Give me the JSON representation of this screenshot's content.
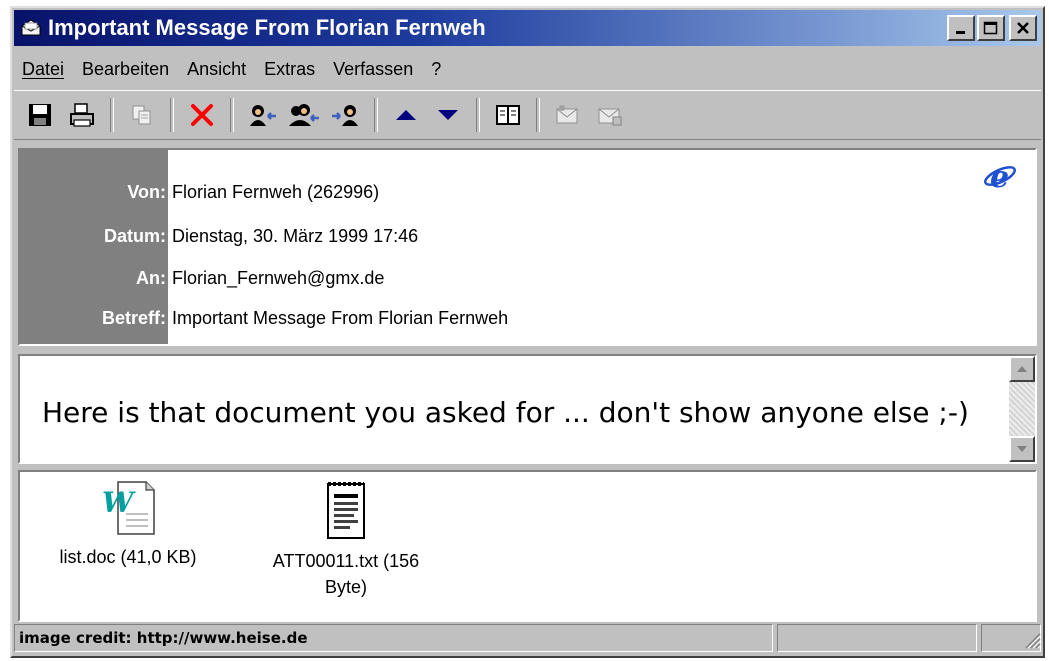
{
  "window": {
    "title": "Important Message From Florian Fernweh",
    "controls": {
      "minimize": "_",
      "maximize": "□",
      "close": "×"
    }
  },
  "menu": {
    "items": [
      "Datei",
      "Bearbeiten",
      "Ansicht",
      "Extras",
      "Verfassen",
      "?"
    ]
  },
  "toolbar": {
    "icons": [
      "save-icon",
      "print-icon",
      "copy-icon",
      "delete-icon",
      "reply-icon",
      "reply-all-icon",
      "forward-icon",
      "previous-icon",
      "next-icon",
      "address-book-icon",
      "send-icon",
      "mail-icon"
    ],
    "delete_color": "#ff0000",
    "arrow_color": "#000080"
  },
  "header": {
    "fields": [
      {
        "label": "Von:",
        "value": "Florian Fernweh (262996)"
      },
      {
        "label": "Datum:",
        "value": "Dienstag, 30. März 1999 17:46"
      },
      {
        "label": "An:",
        "value": "Florian_Fernweh@gmx.de"
      },
      {
        "label": "Betreff:",
        "value": "Important Message From Florian Fernweh"
      }
    ],
    "logo": "ie-logo"
  },
  "message": {
    "text": "Here is that document you asked for ... don't show anyone else ;-)"
  },
  "attachments": [
    {
      "icon": "word-document-icon",
      "name_line1": "list.doc (41,0 KB)",
      "name_line2": ""
    },
    {
      "icon": "text-file-icon",
      "name_line1": "ATT00011.txt (156",
      "name_line2": "Byte)"
    }
  ],
  "statusbar": {
    "text": "image credit: http://www.heise.de"
  },
  "colors": {
    "title_gradient_start": "#08126b",
    "title_gradient_end": "#a8c8ec",
    "label_panel": "#808080",
    "chrome": "#c0c0c0"
  }
}
